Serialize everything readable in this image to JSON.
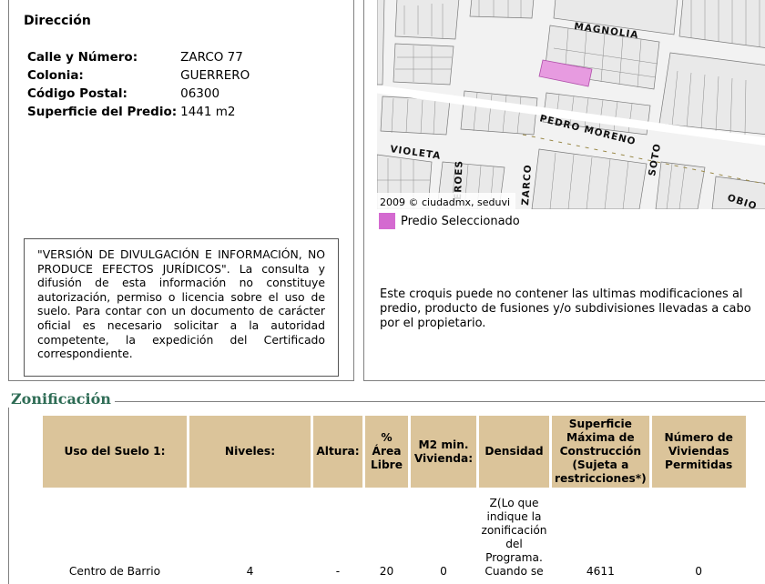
{
  "direccion": {
    "heading": "Dirección",
    "rows": [
      {
        "label": "Calle y Número:",
        "value": "ZARCO 77"
      },
      {
        "label": "Colonia:",
        "value": "GUERRERO"
      },
      {
        "label": "Código Postal:",
        "value": "06300"
      },
      {
        "label": "Superficie del Predio:",
        "value": "1441 m2"
      }
    ],
    "disclaimer": "\"VERSIÓN DE DIVULGACIÓN E INFORMACIÓN, NO PRODUCE EFECTOS JURÍDICOS\". La consulta y difusión de esta información no constituye autorización, permiso o licencia sobre el uso de suelo. Para contar con un documento de carácter oficial es necesario solicitar a la autoridad competente, la expedición del Certificado correspondiente."
  },
  "map": {
    "street_labels": [
      "MAGNOLIA",
      "PEDRO MORENO",
      "VIOLETA",
      "EROES",
      "ZARCO",
      "SOTO",
      "OBIO"
    ],
    "credit": "2009 © ciudadmx, seduvi",
    "legend_label": "Predio Seleccionado",
    "legend_color": "#d46ad0",
    "note": "Este croquis puede no contener las ultimas modificaciones al predio, producto de fusiones y/o subdivisiones llevadas a cabo por el propietario."
  },
  "zonificacion": {
    "title": "Zonificación",
    "header_color": "#dbc49a",
    "title_color": "#2e6c55",
    "columns": [
      "Uso del Suelo 1:",
      "Niveles:",
      "Altura:",
      "% Área Libre",
      "M2 min. Vivienda:",
      "Densidad",
      "Superficie Máxima de Construcción (Sujeta a restricciones*)",
      "Número de Viviendas Permitidas"
    ],
    "row": {
      "uso": "Centro de Barrio",
      "niveles": "4",
      "altura": "-",
      "area_libre": "20",
      "m2_min": "0",
      "densidad": "Z(Lo que indique la zonificación del Programa. Cuando se",
      "superficie": "4611",
      "viviendas": "0"
    }
  }
}
